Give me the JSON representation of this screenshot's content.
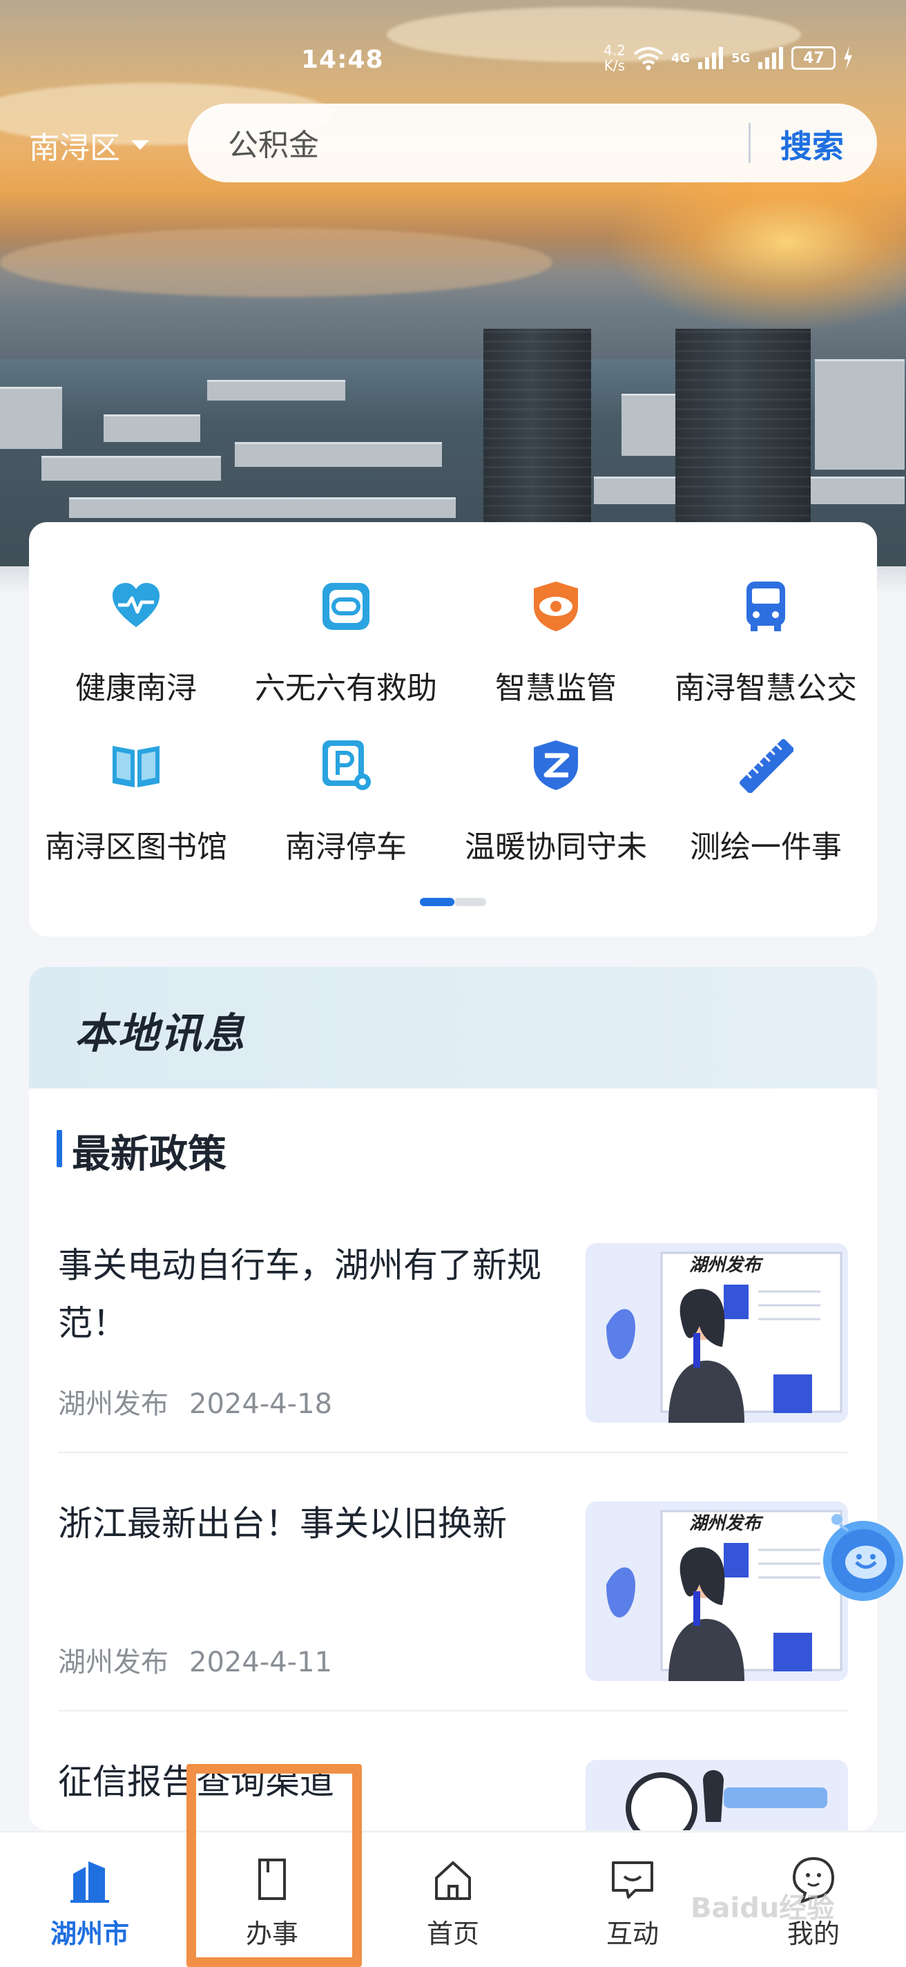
{
  "status_bar": {
    "time": "14:48",
    "net_speed_top": "4.2",
    "net_speed_bottom": "K/s",
    "signal_1": "4G",
    "signal_2": "5G",
    "battery": "47"
  },
  "location": {
    "district": "南浔区"
  },
  "search": {
    "value": "公积金",
    "button_label": "搜索"
  },
  "services": [
    {
      "label": "健康南浔",
      "icon": "heart-pulse-icon"
    },
    {
      "label": "六无六有救助",
      "icon": "link-icon"
    },
    {
      "label": "智慧监管",
      "icon": "eye-shield-icon"
    },
    {
      "label": "南浔智慧公交",
      "icon": "bus-icon"
    },
    {
      "label": "南浔区图书馆",
      "icon": "book-icon"
    },
    {
      "label": "南浔停车",
      "icon": "parking-icon"
    },
    {
      "label": "温暖协同守未",
      "icon": "shield-z-icon"
    },
    {
      "label": "测绘一件事",
      "icon": "ruler-icon"
    }
  ],
  "news": {
    "header_title": "本地讯息",
    "section_title": "最新政策",
    "items": [
      {
        "title": "事关电动自行车，湖州有了新规范！",
        "source": "湖州发布",
        "date": "2024-4-18",
        "thumb_label": "湖州发布"
      },
      {
        "title": "浙江最新出台！事关以旧换新",
        "source": "湖州发布",
        "date": "2024-4-11",
        "thumb_label": "湖州发布"
      },
      {
        "title": "征信报告查询渠道",
        "source": "",
        "date": "",
        "thumb_label": ""
      }
    ]
  },
  "tabs": [
    {
      "label": "湖州市",
      "icon": "city-buildings-icon",
      "active": true
    },
    {
      "label": "办事",
      "icon": "document-icon",
      "active": false
    },
    {
      "label": "首页",
      "icon": "home-icon",
      "active": false
    },
    {
      "label": "互动",
      "icon": "chat-icon",
      "active": false
    },
    {
      "label": "我的",
      "icon": "profile-icon",
      "active": false
    }
  ],
  "colors": {
    "accent": "#1f6fe0",
    "highlight": "#f08f45",
    "service_icon": "#2aa3e0",
    "service_icon_alt": "#f07a2e"
  },
  "watermark": "Baidu经验"
}
